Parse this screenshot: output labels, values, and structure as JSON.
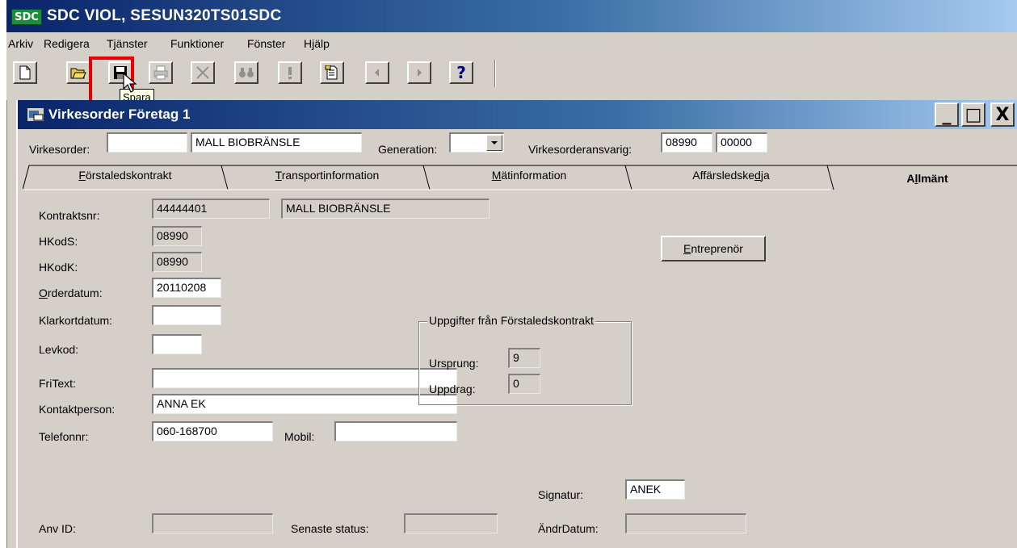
{
  "app": {
    "logo": "SDC",
    "title": "SDC VIOL, SESUN320TS01SDC"
  },
  "menu": [
    "Arkiv",
    "Redigera",
    "Tjänster",
    "Funktioner",
    "Fönster",
    "Hjälp"
  ],
  "toolbar": {
    "buttons": [
      "new-icon",
      "open-icon",
      "save-icon",
      "print-icon",
      "delete-icon",
      "find-icon",
      "alert-icon",
      "document-icon",
      "prev-icon",
      "next-icon",
      "help-icon"
    ],
    "help_glyph": "?",
    "tooltip": "Spara"
  },
  "child": {
    "title": "Virkesorder Företag 1",
    "window_buttons": {
      "minimize": "_",
      "maximize": "□",
      "close": "X"
    }
  },
  "header": {
    "virkesorder_label": "Virkesorder:",
    "virkesorder_value": "",
    "virkesorder_name": "MALL BIOBRÄNSLE",
    "generation_label": "Generation:",
    "generation_value": "",
    "ansvarig_label": "Virkesorderansvarig:",
    "ansvarig_1": "08990",
    "ansvarig_2": "00000"
  },
  "tabs": [
    {
      "pre": "",
      "ul": "F",
      "post": "örstaledskontrakt",
      "active": false
    },
    {
      "pre": "",
      "ul": "T",
      "post": "ransportinformation",
      "active": false
    },
    {
      "pre": "",
      "ul": "M",
      "post": "ätinformation",
      "active": false
    },
    {
      "pre": "Affärsledske",
      "ul": "d",
      "post": "ja",
      "active": false
    },
    {
      "pre": "A",
      "ul": "l",
      "post": "lmänt",
      "active": true
    }
  ],
  "form": {
    "kontraktsnr_label": "Kontraktsnr:",
    "kontraktsnr": "44444401",
    "kontrakt_name": "MALL BIOBRÄNSLE",
    "hkods_label": "HKodS:",
    "hkods": "08990",
    "hkodk_label": "HKodK:",
    "hkodk": "08990",
    "orderdatum_label": "Orderdatum:",
    "orderdatum": "20110208",
    "klarkortdatum_label": "Klarkortdatum:",
    "klarkortdatum": "",
    "levkod_label": "Levkod:",
    "levkod": "",
    "fritext_label": "FriText:",
    "fritext": "",
    "kontaktperson_label": "Kontaktperson:",
    "kontaktperson": "ANNA EK",
    "telefonnr_label": "Telefonnr:",
    "telefonnr": "060-168700",
    "mobil_label": "Mobil:",
    "mobil": "",
    "signatur_label": "Signatur:",
    "signatur": "ANEK",
    "anvid_label": "Anv ID:",
    "anvid": "",
    "senaste_status_label": "Senaste status:",
    "senaste_status": "",
    "andrdatum_label": "ÄndrDatum:",
    "andrdatum": ""
  },
  "group": {
    "title": "Uppgifter från Förstaledskontrakt",
    "ursprung_label": "Ursprung:",
    "ursprung": "9",
    "uppdrag_label": "Uppdrag:",
    "uppdrag": "0"
  },
  "entreprenor_button": {
    "ul": "E",
    "post": "ntreprenör"
  }
}
